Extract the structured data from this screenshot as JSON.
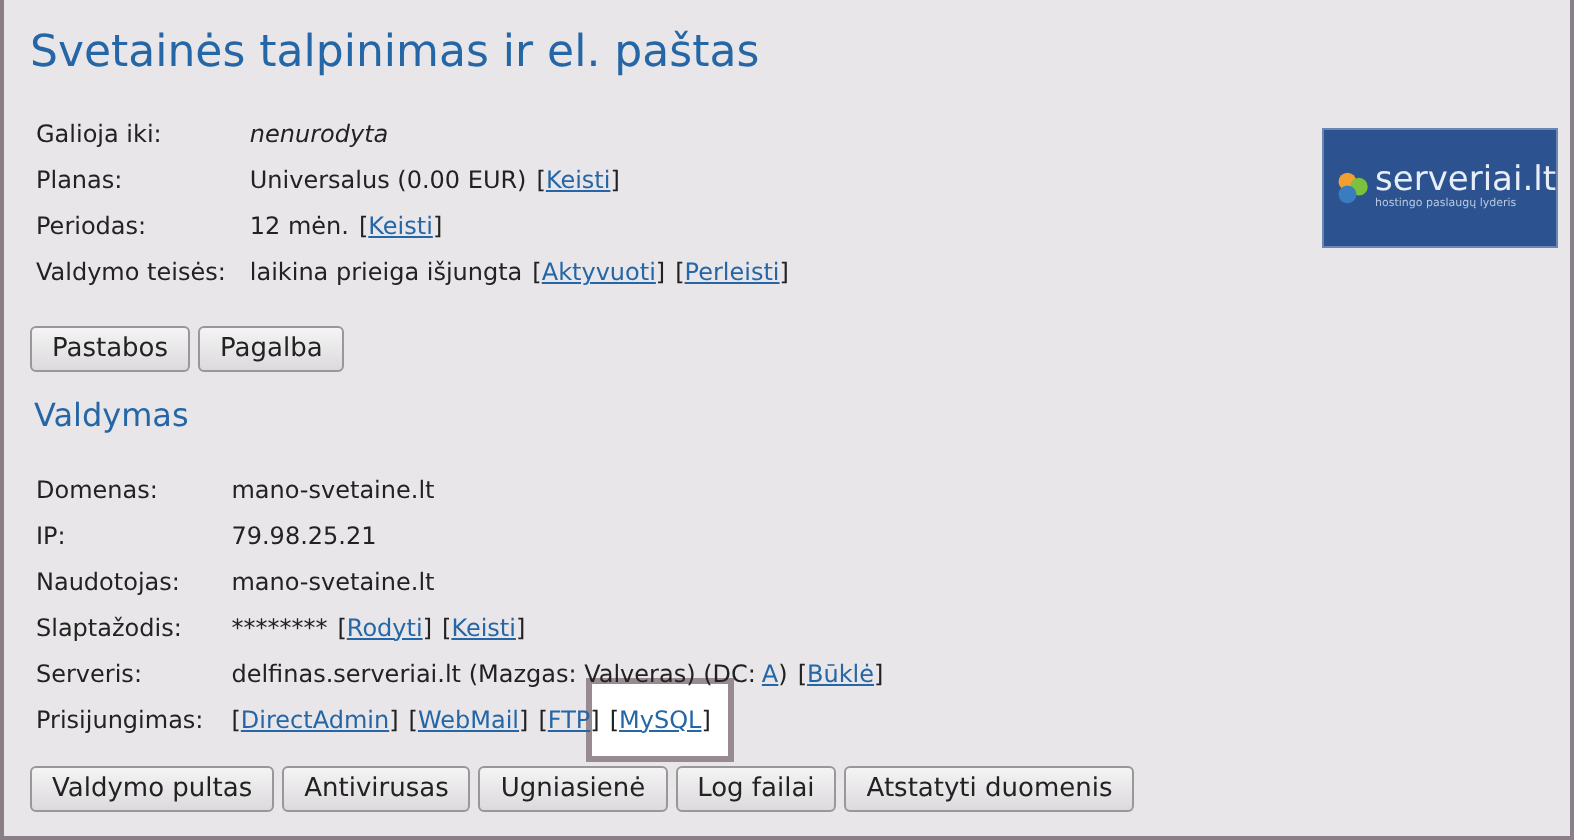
{
  "title": "Svetainės talpinimas ir el. paštas",
  "logo": {
    "name": "serveriai.lt",
    "tagline": "hostingo paslaugų lyderis"
  },
  "info": [
    {
      "label": "Galioja iki:",
      "parts": [
        {
          "kind": "italic",
          "text": "nenurodyta"
        }
      ]
    },
    {
      "label": "Planas:",
      "parts": [
        {
          "kind": "text",
          "text": "Universalus (0.00 EUR)"
        },
        {
          "kind": "link",
          "open": "[",
          "text": "Keisti",
          "close": "]"
        }
      ]
    },
    {
      "label": "Periodas:",
      "parts": [
        {
          "kind": "text",
          "text": "12 mėn."
        },
        {
          "kind": "link",
          "open": "[",
          "text": "Keisti",
          "close": "]"
        }
      ]
    },
    {
      "label": "Valdymo teisės:",
      "parts": [
        {
          "kind": "text",
          "text": "laikina prieiga išjungta"
        },
        {
          "kind": "link",
          "open": "[",
          "text": "Aktyvuoti",
          "close": "]"
        },
        {
          "kind": "link",
          "open": "[",
          "text": "Perleisti",
          "close": "]"
        }
      ]
    }
  ],
  "info_buttons": [
    "Pastabos",
    "Pagalba"
  ],
  "section_title": "Valdymas",
  "details": [
    {
      "label": "Domenas:",
      "parts": [
        {
          "kind": "text",
          "text": "mano-svetaine.lt"
        }
      ]
    },
    {
      "label": "IP:",
      "parts": [
        {
          "kind": "text",
          "text": "79.98.25.21"
        }
      ]
    },
    {
      "label": "Naudotojas:",
      "parts": [
        {
          "kind": "text",
          "text": "mano-svetaine.lt"
        }
      ]
    },
    {
      "label": "Slaptažodis:",
      "parts": [
        {
          "kind": "text",
          "text": "********"
        },
        {
          "kind": "link",
          "open": "[",
          "text": "Rodyti",
          "close": "]"
        },
        {
          "kind": "link",
          "open": "[",
          "text": "Keisti",
          "close": "]"
        }
      ]
    },
    {
      "label": "Serveris:",
      "parts": [
        {
          "kind": "text",
          "text": "delfinas.serveriai.lt (Mazgas: Valveras) (DC:"
        },
        {
          "kind": "inline-link",
          "text": "A"
        },
        {
          "kind": "text",
          "text": ")"
        },
        {
          "kind": "link",
          "open": "[",
          "text": "Būklė",
          "close": "]"
        }
      ]
    },
    {
      "label": "Prisijungimas:",
      "parts": [
        {
          "kind": "link",
          "open": "[",
          "text": "DirectAdmin",
          "close": "]"
        },
        {
          "kind": "link",
          "open": "[",
          "text": "WebMail",
          "close": "]"
        },
        {
          "kind": "link",
          "open": "[",
          "text": "FTP",
          "close": "]"
        },
        {
          "kind": "link",
          "open": "[",
          "text": "MySQL",
          "close": "]",
          "highlighted": true
        }
      ]
    }
  ],
  "buttons": [
    "Valdymo pultas",
    "Antivirusas",
    "Ugniasienė",
    "Log failai",
    "Atstatyti duomenis"
  ]
}
